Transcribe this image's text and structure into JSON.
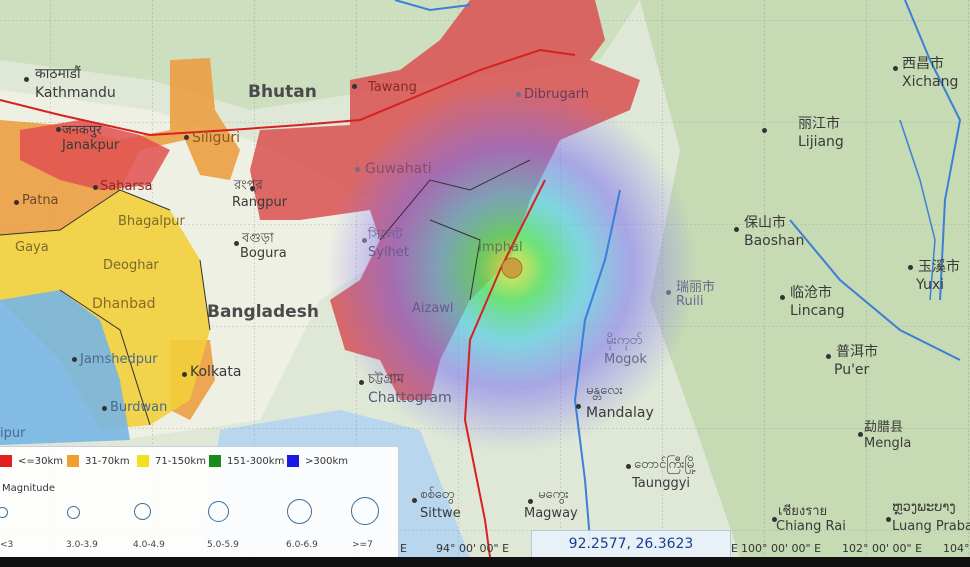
{
  "map": {
    "colors": {
      "band_le30": "#e02020",
      "band_31_70": "#f0a030",
      "band_71_150": "#f5e020",
      "band_151_300": "#1a8a1a",
      "band_gt300": "#1a1ae0",
      "epicenter": "#c8a040",
      "fault": "#d82020",
      "river": "#3a7fd8"
    },
    "countries": [
      "Bhutan",
      "Bangladesh"
    ],
    "cities": {
      "kathmandu_native": "काठमाडौं",
      "kathmandu": "Kathmandu",
      "janakpur_native": "जनकपुर",
      "janakpur": "Janakpur",
      "siliguri": "Siliguri",
      "tawang": "Tawang",
      "dibrugarh": "Dibrugarh",
      "saharsa": "Saharsa",
      "patna": "Patna",
      "guwahati": "Guwahati",
      "rangpur_native": "রংপুর",
      "rangpur": "Rangpur",
      "bhagalpur": "Bhagalpur",
      "gaya": "Gaya",
      "deoghar": "Deoghar",
      "bogura_native": "বগুড়া",
      "bogura": "Bogura",
      "sylhet_native": "সিলেট",
      "sylhet": "Sylhet",
      "imphal": "Imphal",
      "dhanbad": "Dhanbad",
      "aizawl": "Aizawl",
      "jamshedpur": "Jamshedpur",
      "kolkata": "Kolkata",
      "chattogram_native": "চট্টগ্রাম",
      "chattogram": "Chattogram",
      "burdwan": "Burdwan",
      "raipur_frag": "ipur",
      "ruili_native": "瑞丽市",
      "ruili": "Ruili",
      "mogok_native": "မိုးကုတ်",
      "mogok": "Mogok",
      "mandalay_native": "မန္တလေး",
      "mandalay": "Mandalay",
      "taunggyi_native": "တောင်ကြီးမြို့",
      "taunggyi": "Taunggyi",
      "sittwe_native": "စစ်တွေ",
      "sittwe": "Sittwe",
      "magway_native": "မကွေး",
      "magway": "Magway",
      "xichang_native": "西昌市",
      "xichang": "Xichang",
      "lijiang_native": "丽江市",
      "lijiang": "Lijiang",
      "baoshan_native": "保山市",
      "baoshan": "Baoshan",
      "yuxi_native": "玉溪市",
      "yuxi": "Yuxi",
      "lincang_native": "临沧市",
      "lincang": "Lincang",
      "puer_native": "普洱市",
      "puer": "Pu'er",
      "mengla_native": "勐腊县",
      "mengla": "Mengla",
      "chiangrai_native": "เชียงราย",
      "chiangrai": "Chiang Rai",
      "luangprabang_native": "ຫຼວງພະບາງ",
      "luangprabang": "Luang Praba"
    }
  },
  "legend": {
    "bands": [
      {
        "label": "<=30km",
        "color": "#e02020"
      },
      {
        "label": "31-70km",
        "color": "#f0a030"
      },
      {
        "label": "71-150km",
        "color": "#f5e020"
      },
      {
        "label": "151-300km",
        "color": "#1a8a1a"
      },
      {
        "label": ">300km",
        "color": "#1a1ae0"
      }
    ],
    "magnitude_title": "Magnitude",
    "magnitudes": [
      "<3",
      "3.0-3.9",
      "4.0-4.9",
      "5.0-5.9",
      "6.0-6.9",
      ">=7"
    ]
  },
  "coordinates": "92.2577, 26.3623",
  "grid_labels": [
    "E",
    "94° 00' 00\" E",
    "E",
    "100° 00' 00\" E",
    "102° 00' 00\" E",
    "104°"
  ]
}
